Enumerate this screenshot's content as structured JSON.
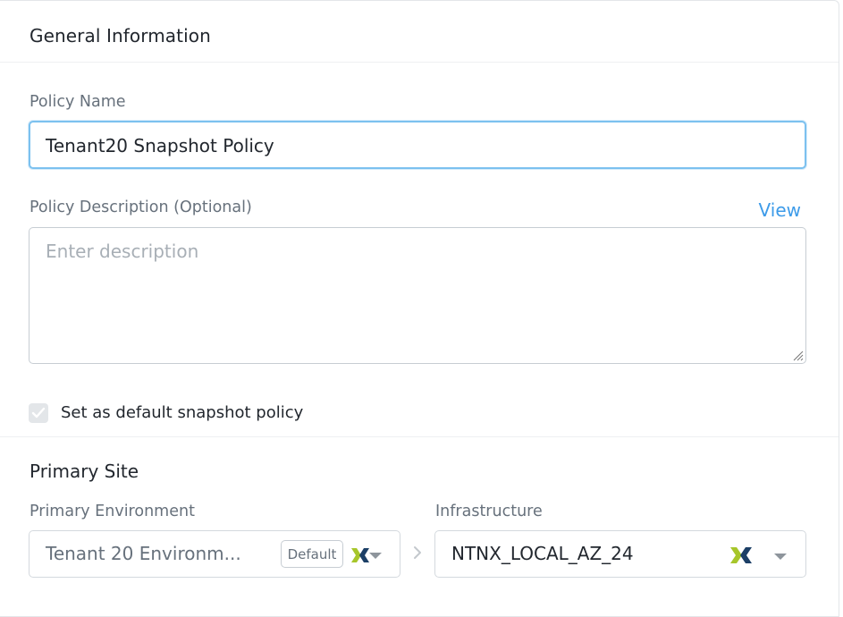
{
  "general": {
    "title": "General Information",
    "policy_name_label": "Policy Name",
    "policy_name_value": "Tenant20 Snapshot Policy",
    "description_label": "Policy Description (Optional)",
    "description_placeholder": "Enter description",
    "view_link": "View",
    "default_checkbox_label": "Set as default snapshot policy",
    "default_checkbox_checked": true
  },
  "primary_site": {
    "title": "Primary Site",
    "environment_label": "Primary Environment",
    "environment_value": "Tenant 20 Environm...",
    "environment_badge": "Default",
    "infrastructure_label": "Infrastructure",
    "infrastructure_value": "NTNX_LOCAL_AZ_24"
  },
  "icons": {
    "provider": "nutanix-x-icon",
    "caret": "caret-down-icon",
    "separator": "chevron-right-icon"
  },
  "colors": {
    "focus_border": "#7cc1ef",
    "link": "#3d9be9",
    "nutanix_green": "#a7c62b",
    "nutanix_navy": "#1c3f66"
  }
}
